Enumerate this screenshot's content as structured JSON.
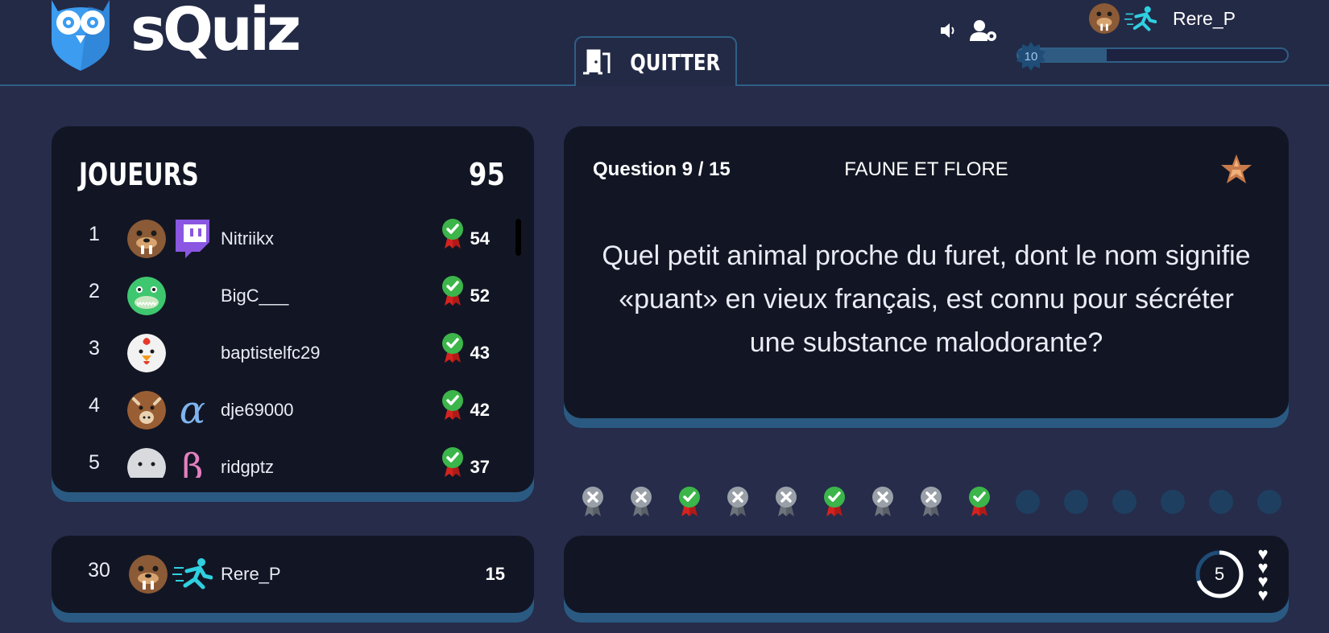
{
  "app": {
    "name": "sQuiz"
  },
  "header": {
    "quit_label": "QUITTER",
    "profile_name": "Rere_P",
    "level": "10",
    "xp_progress": 0.33,
    "icons": [
      "speaker-icon",
      "user-settings-icon"
    ]
  },
  "players": {
    "title": "JOUEURS",
    "count": "95",
    "rows": [
      {
        "rank": "1",
        "name": "Nitriikx",
        "score": "54",
        "avatar": "walrus-avatar",
        "badge": "twitch-icon",
        "correct": true
      },
      {
        "rank": "2",
        "name": "BigC___",
        "score": "52",
        "avatar": "crocodile-avatar",
        "badge": "",
        "correct": true
      },
      {
        "rank": "3",
        "name": "baptistelfc29",
        "score": "43",
        "avatar": "chicken-avatar",
        "badge": "",
        "correct": true
      },
      {
        "rank": "4",
        "name": "dje69000",
        "score": "42",
        "avatar": "moose-avatar",
        "badge": "alpha-icon",
        "correct": true
      },
      {
        "rank": "5",
        "name": "ridgptz",
        "score": "37",
        "avatar": "seal-avatar",
        "badge": "beta-icon",
        "correct": true
      }
    ]
  },
  "me": {
    "rank": "30",
    "name": "Rere_P",
    "score": "15",
    "avatar": "walrus-avatar",
    "badge": "runner-icon"
  },
  "question": {
    "number": "Question 9 / 15",
    "category": "FAUNE ET FLORE",
    "text": "Quel petit animal proche du furet, dont le nom signifie «puant» en vieux français, est connu pour sécréter une substance malodorante?"
  },
  "progress": [
    "wrong",
    "wrong",
    "correct",
    "wrong",
    "wrong",
    "correct",
    "wrong",
    "wrong",
    "correct",
    "pending",
    "pending",
    "pending",
    "pending",
    "pending",
    "pending"
  ],
  "answer": {
    "timer": "5",
    "timer_fraction": 0.7,
    "lives": 4
  },
  "colors": {
    "background": "#262c4a",
    "card": "#121624",
    "card_shadow": "#2a5a82",
    "accent_blue": "#3b9cf0",
    "correct_green": "#3cb54a",
    "ribbon_red": "#d4231f",
    "wrong_gray": "#9aa0a8",
    "pending_dot": "#1f3f60"
  }
}
